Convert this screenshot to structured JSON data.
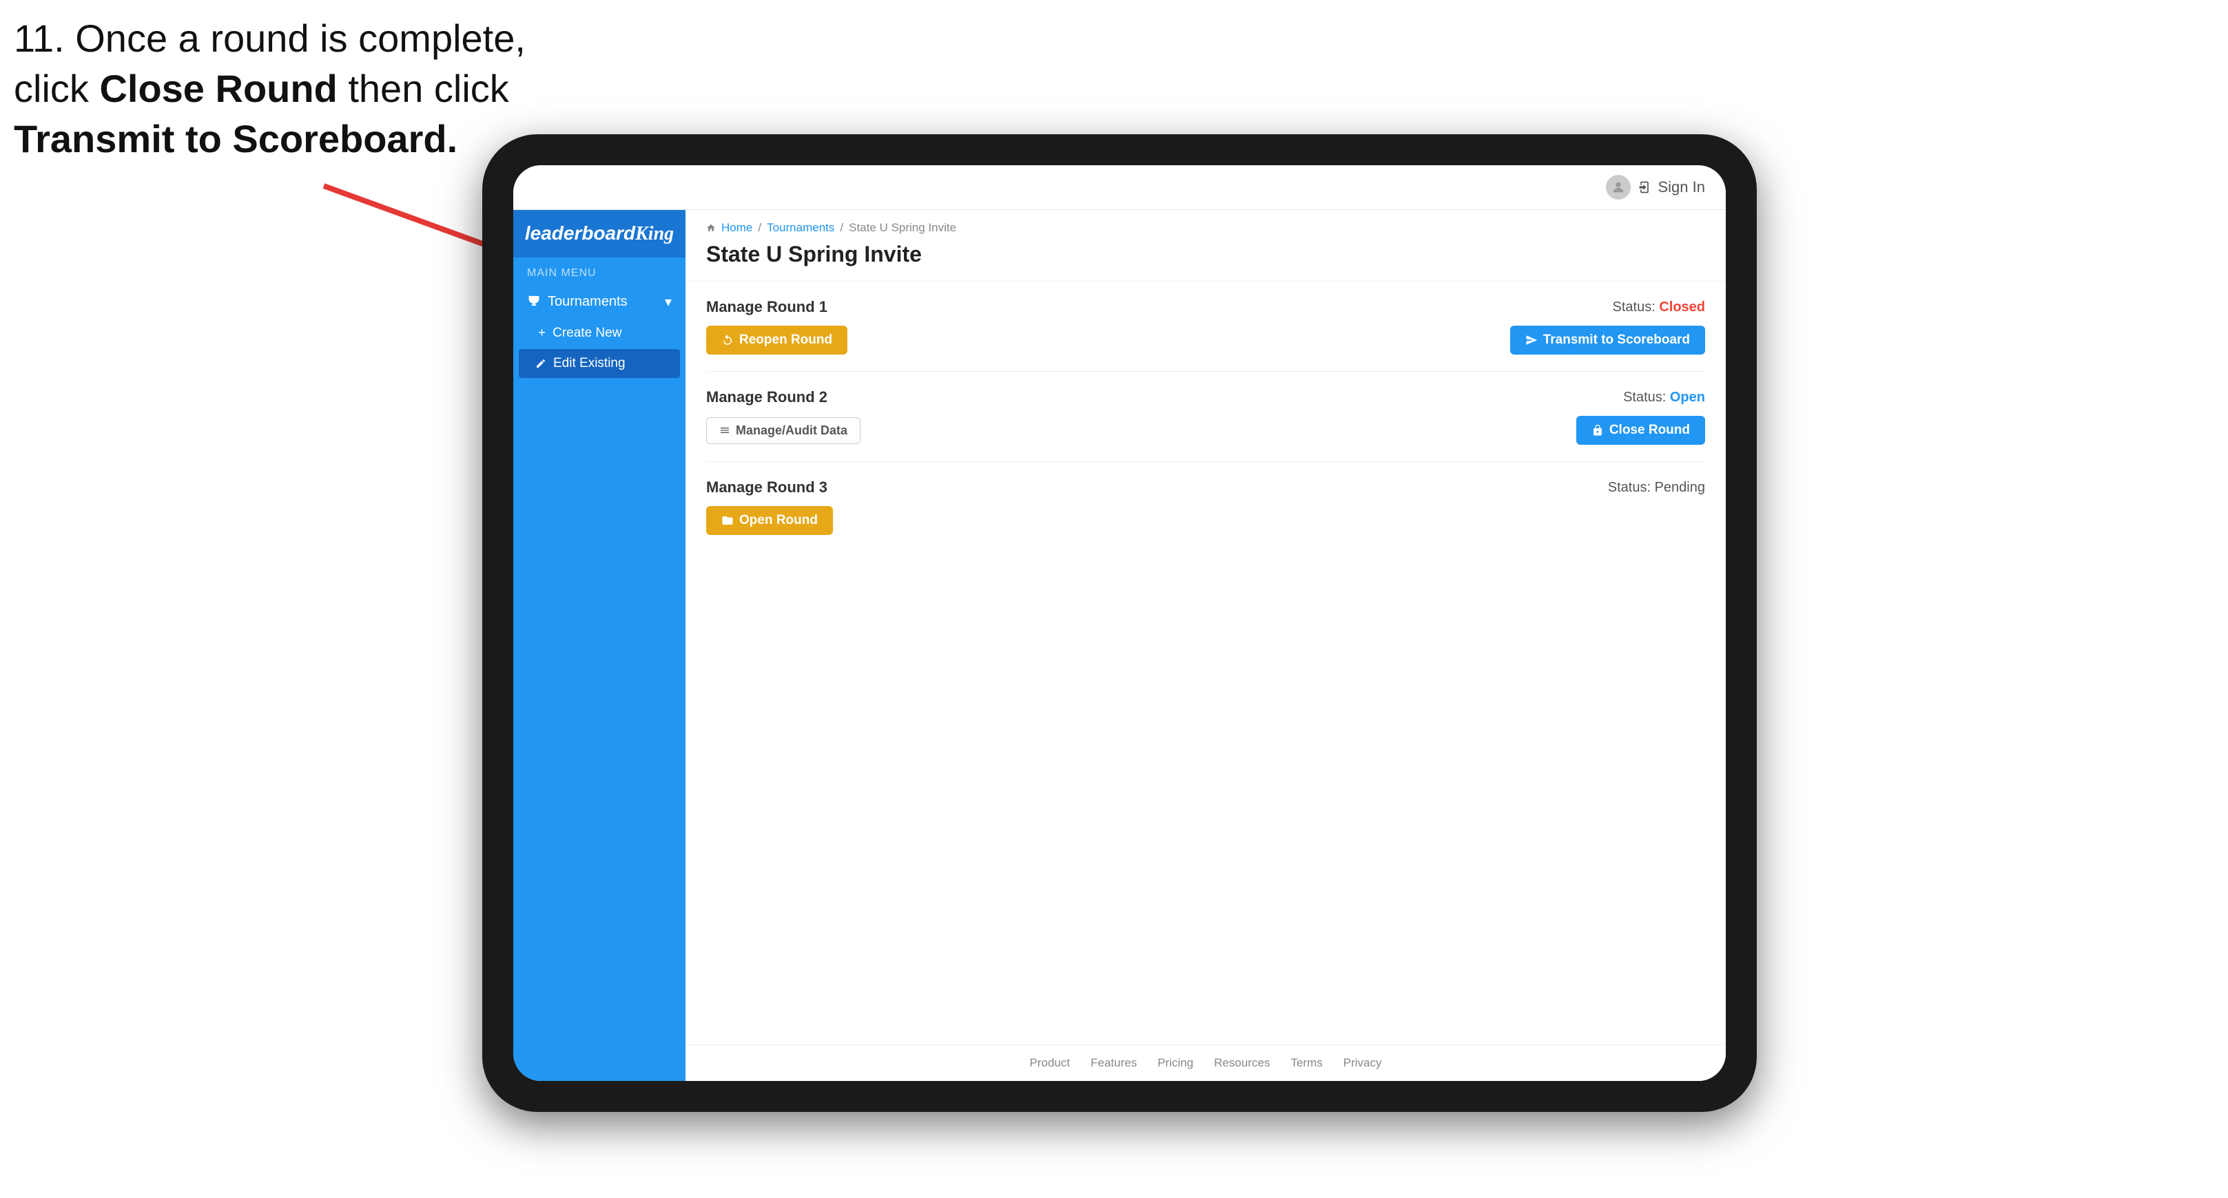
{
  "instruction": {
    "line1": "11. Once a round is complete,",
    "line2": "click ",
    "bold1": "Close Round",
    "line3": " then click",
    "bold2": "Transmit to Scoreboard."
  },
  "header": {
    "sign_in": "Sign In",
    "avatar": "👤"
  },
  "breadcrumb": {
    "home": "Home",
    "separator1": "/",
    "tournaments": "Tournaments",
    "separator2": "/",
    "current": "State U Spring Invite"
  },
  "page": {
    "title": "State U Spring Invite"
  },
  "sidebar": {
    "logo": "leaderboard",
    "logo_king": "King",
    "main_menu_label": "MAIN MENU",
    "tournaments_label": "Tournaments",
    "create_new_label": "Create New",
    "edit_existing_label": "Edit Existing"
  },
  "rounds": [
    {
      "title": "Manage Round 1",
      "status_label": "Status:",
      "status_value": "Closed",
      "status_class": "status-closed",
      "primary_btn": {
        "label": "Reopen Round",
        "class": "btn-gold"
      },
      "secondary_btn": {
        "label": "Transmit to Scoreboard",
        "class": "btn-blue"
      }
    },
    {
      "title": "Manage Round 2",
      "status_label": "Status:",
      "status_value": "Open",
      "status_class": "status-open",
      "primary_btn": {
        "label": "Manage/Audit Data",
        "class": "btn-outline"
      },
      "secondary_btn": {
        "label": "Close Round",
        "class": "btn-blue"
      }
    },
    {
      "title": "Manage Round 3",
      "status_label": "Status:",
      "status_value": "Pending",
      "status_class": "status-pending",
      "primary_btn": {
        "label": "Open Round",
        "class": "btn-gold"
      },
      "secondary_btn": null
    }
  ],
  "footer": {
    "links": [
      "Product",
      "Features",
      "Pricing",
      "Resources",
      "Terms",
      "Privacy"
    ]
  }
}
